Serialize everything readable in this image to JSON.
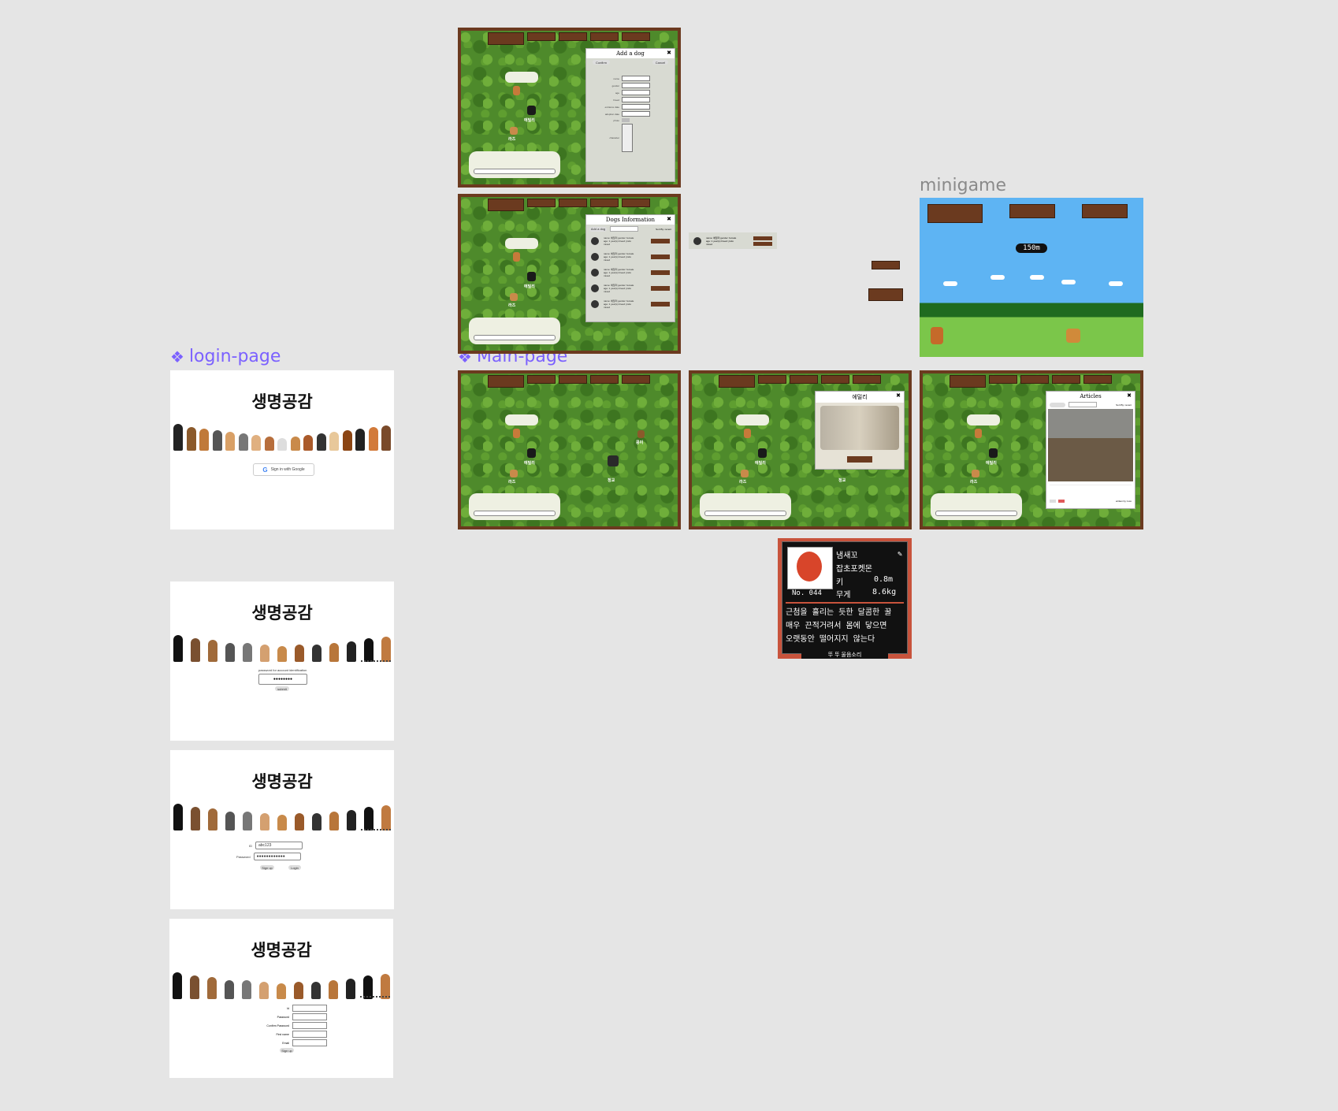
{
  "labels": {
    "login": "login-page",
    "main": "Main-page",
    "minigame": "minigame"
  },
  "login": {
    "title": "생명공감",
    "google_button": "Sign in with Google",
    "password_prompt": "password for account identification",
    "password_value": "●●●●●●●●",
    "password_submit": "submit",
    "id_label": "ID",
    "id_value": "abc123",
    "password_label": "Password",
    "password_dots": "●●●●●●●●●●●●",
    "signup_button": "Sign up",
    "login_button": "Login",
    "signup_fields": [
      "Id",
      "Password",
      "Confirm Password",
      "First name",
      "Email"
    ],
    "signup_submit": "Sign up"
  },
  "main": {
    "add_dog": {
      "title": "Add a dog",
      "confirm": "Confirm",
      "cancel": "Cancel",
      "fields": [
        "name",
        "gender",
        "age",
        "breed",
        "entrance date",
        "adoption date",
        "photo",
        "character"
      ]
    },
    "dogs_info": {
      "title": "Dogs Information",
      "add_button": "Add a dog",
      "sort_label": "Sort By: recent",
      "item_text": "name: 에밀리 gender: female age: 1 year(s) breed: jindo mixed"
    },
    "dog_popup": {
      "name": "에밀리"
    },
    "articles": {
      "title": "Articles",
      "sort_label": "Sort By: recent",
      "author": "written by: loco"
    },
    "names": [
      "에밀리",
      "라즈",
      "콩이",
      "정교"
    ]
  },
  "pokedex": {
    "name": "냄새꼬",
    "type": "잡초포켓몬",
    "height_label": "키",
    "height_value": "0.8m",
    "weight_label": "무게",
    "weight_value": "8.6kg",
    "number": "No. 044",
    "desc1": "근첨을 흘리는 듯한 달콤한 꿀",
    "desc2": "매우 끈적거려서 몸에 닿으면",
    "desc3": "오랫동안 떨어지지 않는다",
    "footer": "뚜 뚜      울음소리"
  },
  "minigame": {
    "score": "150m"
  },
  "colors": {
    "canvas": "#e5e5e5",
    "label_purple": "#7b61ff",
    "wood": "#6b3a1f",
    "grass": "#4e8a2b"
  }
}
